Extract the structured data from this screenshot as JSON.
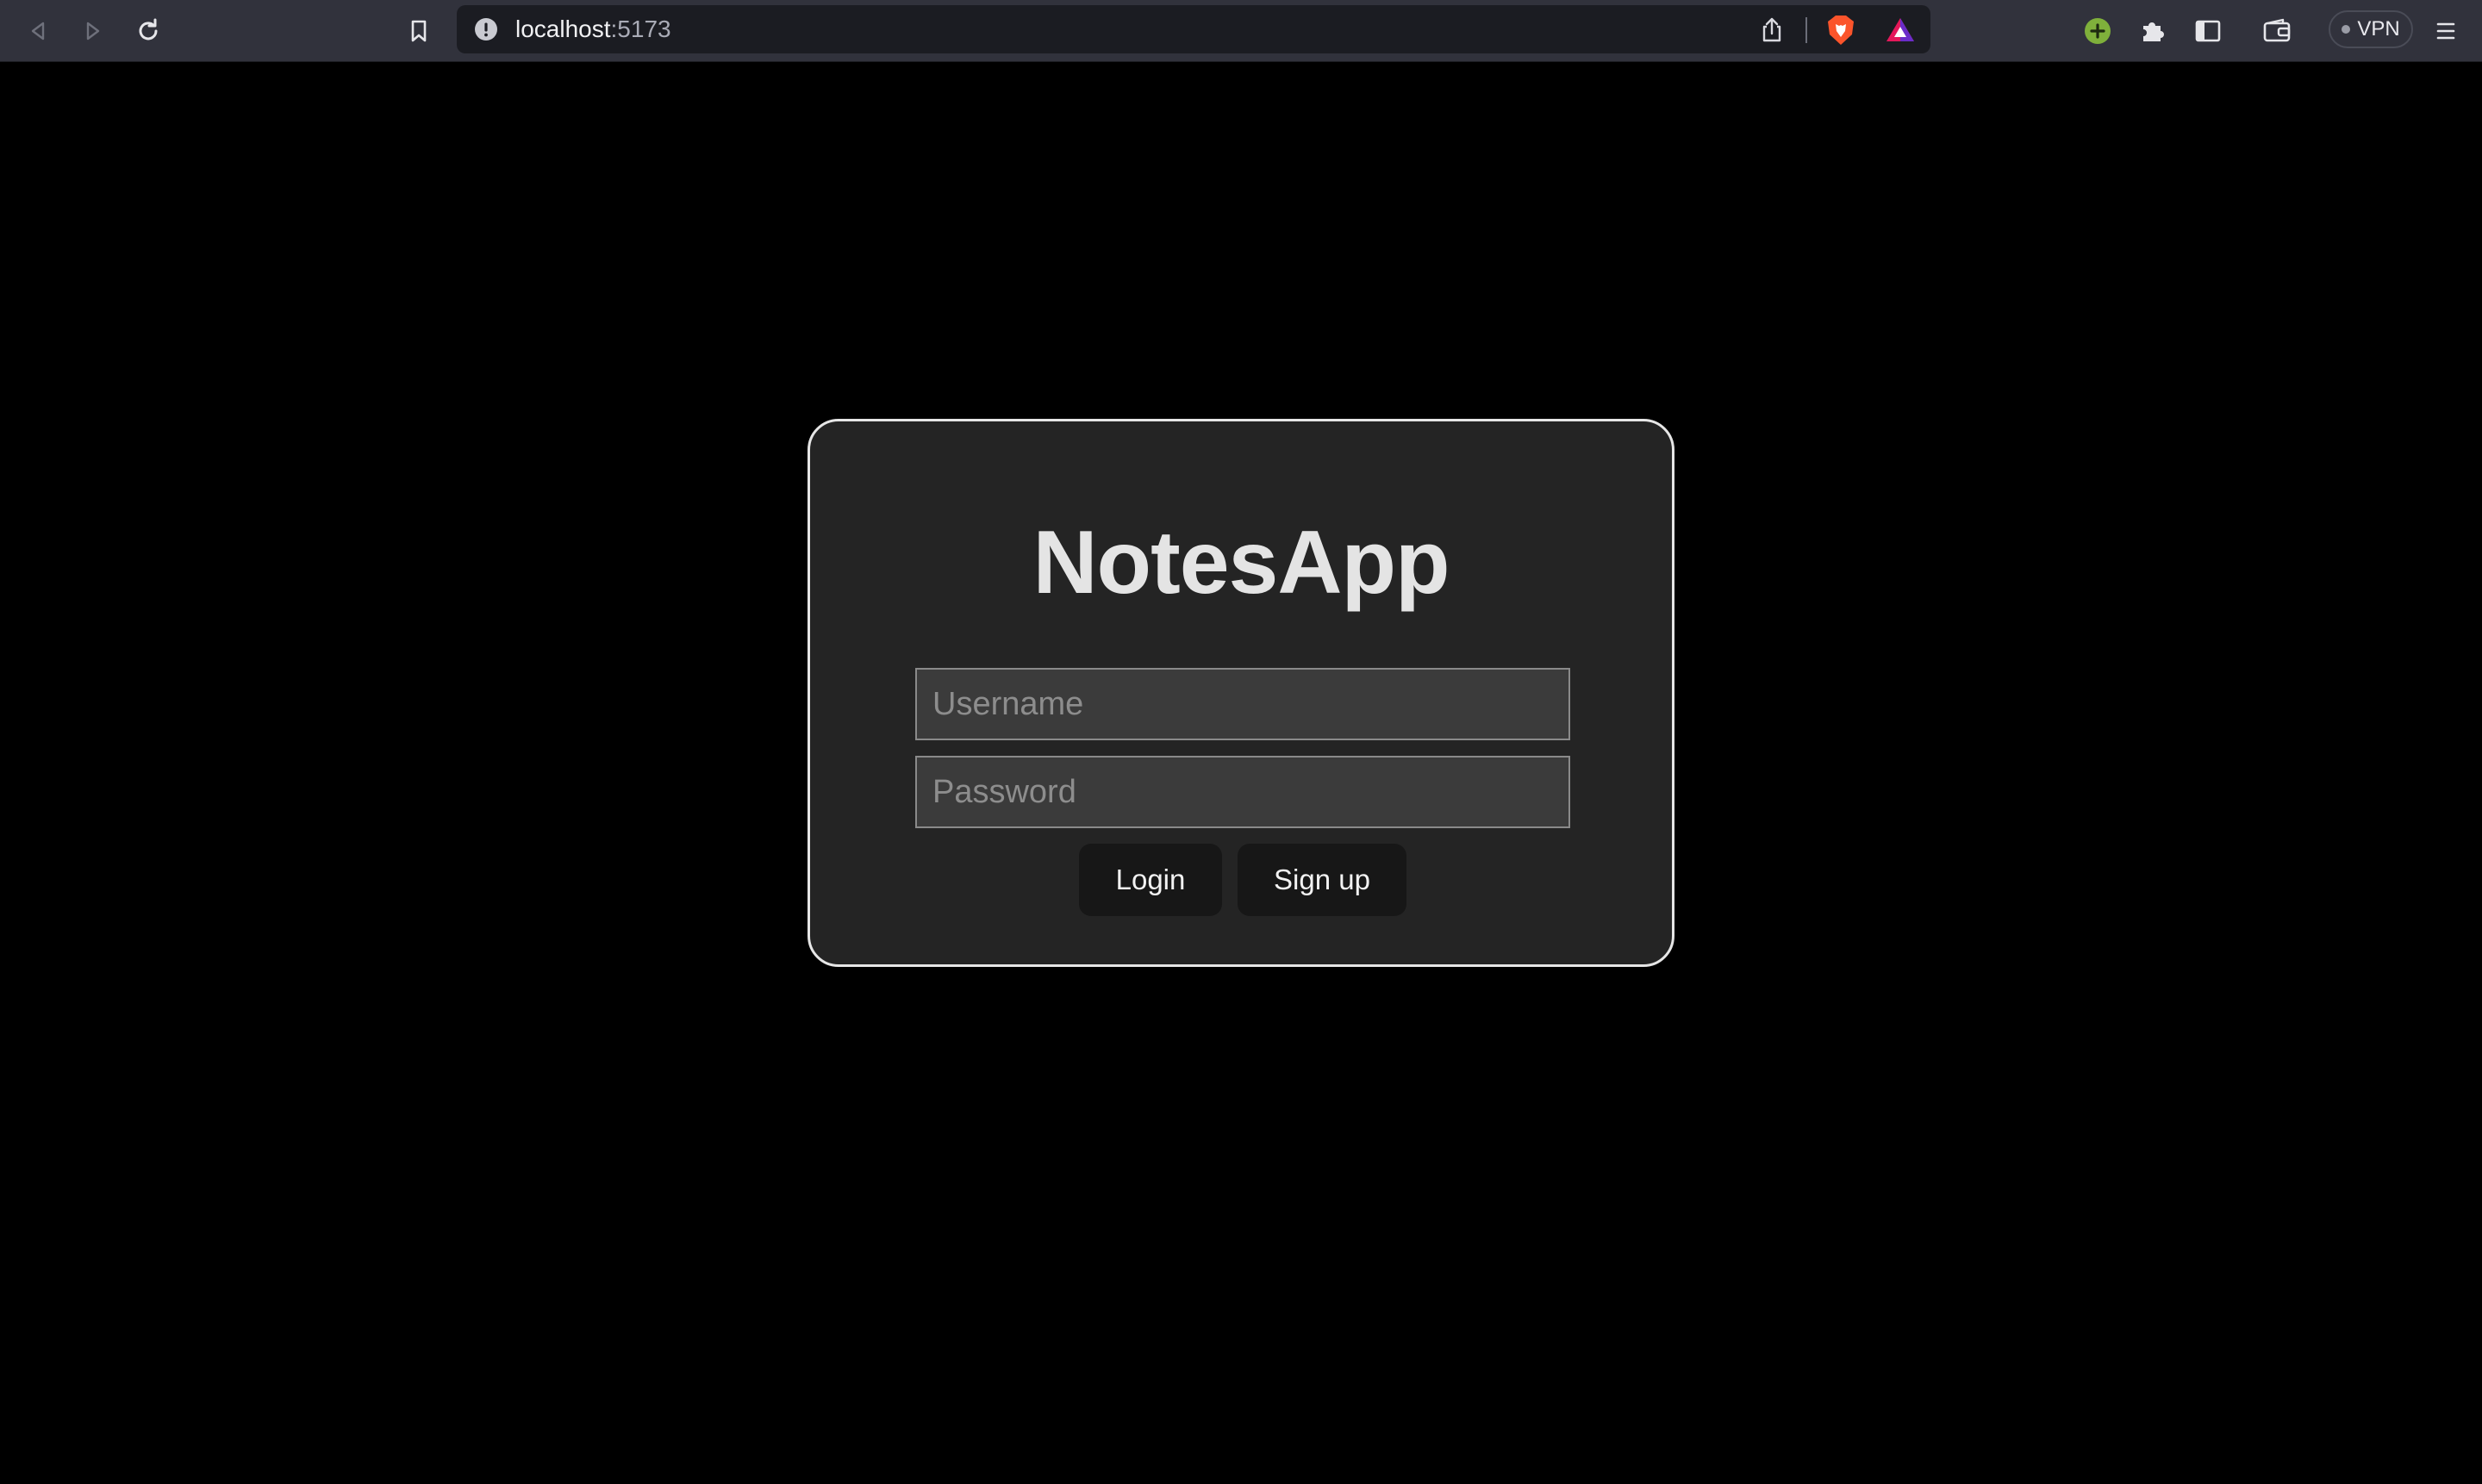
{
  "browser": {
    "url_host": "localhost",
    "url_port": ":5173",
    "vpn_label": "VPN",
    "icons": {
      "back": "back-arrow-icon",
      "forward": "forward-arrow-icon",
      "reload": "reload-icon",
      "bookmark": "bookmark-icon",
      "site_info": "site-info-icon",
      "share": "share-icon",
      "brave_shields": "brave-shield-icon",
      "rewards": "brave-rewards-icon",
      "extension_added": "extension-plus-icon",
      "extensions": "puzzle-piece-icon",
      "sidebar": "sidebar-toggle-icon",
      "wallet": "wallet-icon",
      "menu": "hamburger-menu-icon"
    },
    "colors": {
      "toolbar": "#31323c",
      "urlbar": "#1b1c22",
      "brave_orange": "#fb542b",
      "extension_green": "#7fb03b"
    }
  },
  "app": {
    "title": "NotesApp",
    "username_placeholder": "Username",
    "password_placeholder": "Password",
    "username_value": "",
    "password_value": "",
    "login_label": "Login",
    "signup_label": "Sign up",
    "colors": {
      "background": "#000000",
      "card": "#242424",
      "card_border": "#e6e6e6",
      "input_bg": "#3b3b3b",
      "button_bg": "#171717"
    }
  }
}
